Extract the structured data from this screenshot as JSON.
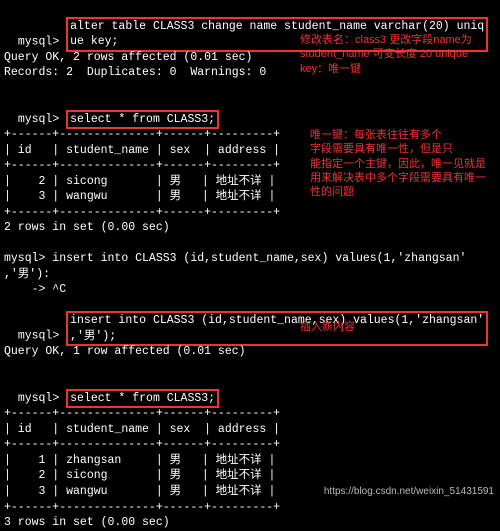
{
  "cmd1_a": "mysql> ",
  "cmd1_b": "alter table CLASS3 change name student_name varchar(20) uniq",
  "cmd1_c": "ue key;",
  "res1a": "Query OK, 2 rows affected (0.01 sec)",
  "res1b": "Records: 2  Duplicates: 0  Warnings: 0",
  "blank": " ",
  "cmd2_a": "mysql> ",
  "cmd2_b": "select * from CLASS3;",
  "sep": "+------+--------------+------+---------+",
  "hdr": "| id   | student_name | sex  | address |",
  "row_a": "|    2 | sicong       | 男   | 地址不详 |",
  "row_b": "|    3 | wangwu       | 男   | 地址不详 |",
  "res2": "2 rows in set (0.00 sec)",
  "cmd3a": "mysql> insert into CLASS3 (id,student_name,sex) values(1,'zhangsan'",
  "cmd3b": ",'男'):",
  "cmd3c": "    -> ^C",
  "cmd4_a": "mysql> ",
  "cmd4_b": "insert into CLASS3 (id,student_name,sex) values(1,'zhangsan'",
  "cmd4_c": ",'男');",
  "res4": "Query OK, 1 row affected (0.01 sec)",
  "cmd5_a": "mysql> ",
  "cmd5_b": "select * from CLASS3;",
  "row_c": "|    1 | zhangsan     | 男   | 地址不详 |",
  "res5": "3 rows in set (0.00 sec)",
  "note1a": "修改表名：class3 更改字段name为",
  "note1b": "student_name 可变长度 20 unique",
  "note1c": "key：唯一键",
  "note2a": "唯一键：每张表往往有多个",
  "note2b": "字段需要具有唯一性，但是只",
  "note2c": "能指定一个主键，因此，唯一见就是",
  "note2d": "用来解决表中多个字段需要具有唯一",
  "note2e": "性的问题",
  "note3": "插入新内容",
  "watermark": "https://blog.csdn.net/weixin_51431591",
  "chart_data": {
    "type": "table",
    "title": "CLASS3",
    "columns": [
      "id",
      "student_name",
      "sex",
      "address"
    ],
    "before_insert": [
      {
        "id": 2,
        "student_name": "sicong",
        "sex": "男",
        "address": "地址不详"
      },
      {
        "id": 3,
        "student_name": "wangwu",
        "sex": "男",
        "address": "地址不详"
      }
    ],
    "after_insert": [
      {
        "id": 1,
        "student_name": "zhangsan",
        "sex": "男",
        "address": "地址不详"
      },
      {
        "id": 2,
        "student_name": "sicong",
        "sex": "男",
        "address": "地址不详"
      },
      {
        "id": 3,
        "student_name": "wangwu",
        "sex": "男",
        "address": "地址不详"
      }
    ]
  }
}
